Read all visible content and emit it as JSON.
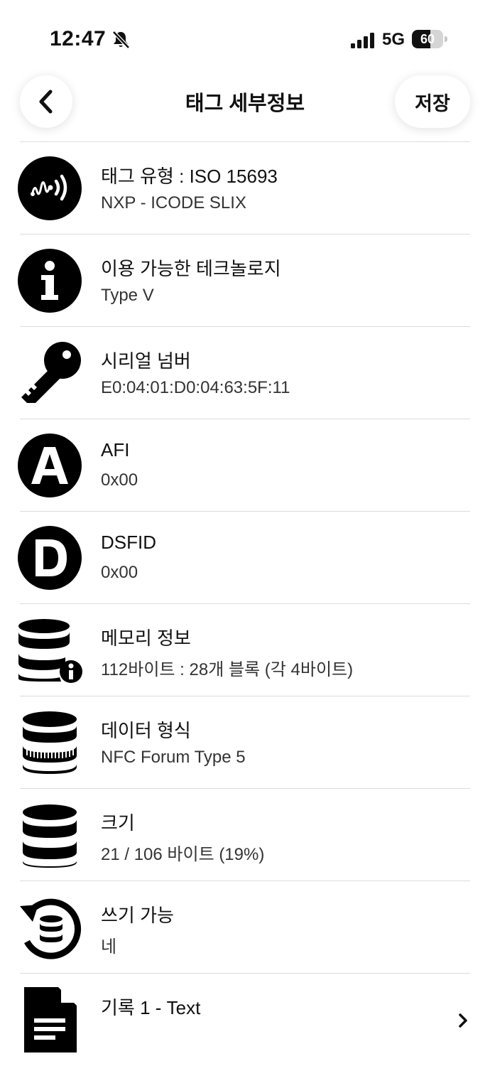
{
  "status_bar": {
    "time": "12:47",
    "network": "5G",
    "battery": "60",
    "battery_level": 0.6,
    "icons": [
      "bell-muted-icon",
      "cellular-signal-icon",
      "battery-icon"
    ]
  },
  "nav": {
    "title": "태그 세부정보",
    "back_icon": "chevron-left-icon",
    "save_label": "저장"
  },
  "rows": [
    {
      "icon": "nfc-waves-icon",
      "title": "태그 유형 : ISO 15693",
      "value": "NXP - ICODE SLIX"
    },
    {
      "icon": "info-icon",
      "title": "이용 가능한 테크놀로지",
      "value": "Type V"
    },
    {
      "icon": "key-icon",
      "title": "시리얼 넘버",
      "value": "E0:04:01:D0:04:63:5F:11"
    },
    {
      "icon": "letter-a-icon",
      "title": "AFI",
      "value": "0x00"
    },
    {
      "icon": "letter-d-icon",
      "title": "DSFID",
      "value": "0x00"
    },
    {
      "icon": "database-info-icon",
      "title": "메모리 정보",
      "value": "112바이트 : 28개 블록 (각 4바이트)"
    },
    {
      "icon": "database-barcode-icon",
      "title": "데이터 형식",
      "value": "NFC Forum Type 5"
    },
    {
      "icon": "database-icon",
      "title": "크기",
      "value": "21 / 106 바이트 (19%)"
    },
    {
      "icon": "database-sync-icon",
      "title": "쓰기 가능",
      "value": "네"
    },
    {
      "icon": "document-icon",
      "title": "기록 1 - Text",
      "value": "",
      "chevron": "chevron-right-icon"
    }
  ],
  "colors": {
    "text": "#111111",
    "secondary_text": "#333333",
    "divider": "#dcdcdc",
    "background": "#ffffff"
  }
}
